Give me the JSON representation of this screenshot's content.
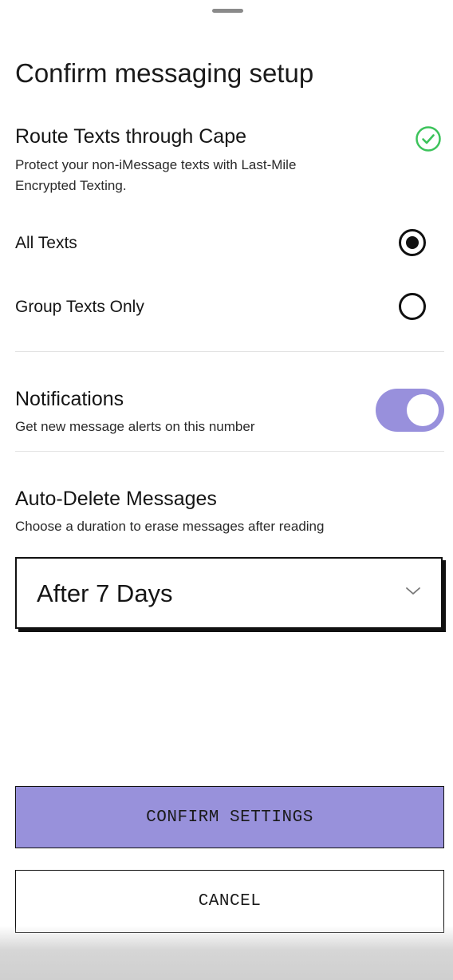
{
  "sheet": {
    "title": "Confirm messaging setup"
  },
  "route": {
    "heading": "Route Texts through Cape",
    "description": "Protect your non-iMessage texts with Last-Mile Encrypted Texting.",
    "status_icon": "check-circle-icon",
    "status_color": "#3cc35b",
    "options": [
      {
        "label": "All Texts",
        "selected": true
      },
      {
        "label": "Group Texts Only",
        "selected": false
      }
    ]
  },
  "notifications": {
    "heading": "Notifications",
    "description": "Get new message alerts on this number",
    "enabled": true,
    "toggle_color": "#9890dc"
  },
  "auto_delete": {
    "heading": "Auto-Delete Messages",
    "description": "Choose a duration to erase messages after reading",
    "selected": "After 7 Days",
    "dropdown_icon": "chevron-down-icon"
  },
  "actions": {
    "confirm_label": "CONFIRM SETTINGS",
    "confirm_color": "#9891db",
    "cancel_label": "CANCEL"
  }
}
